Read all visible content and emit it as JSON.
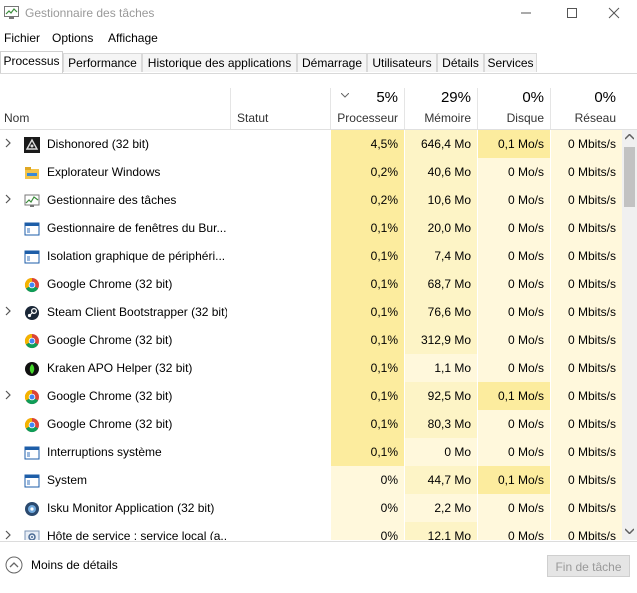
{
  "window": {
    "title": "Gestionnaire des tâches"
  },
  "menu": [
    "Fichier",
    "Options",
    "Affichage"
  ],
  "tabs": [
    "Processus",
    "Performance",
    "Historique des applications",
    "Démarrage",
    "Utilisateurs",
    "Détails",
    "Services"
  ],
  "columns": {
    "name": "Nom",
    "status": "Statut",
    "cpu": {
      "pct": "5%",
      "label": "Processeur"
    },
    "mem": {
      "pct": "29%",
      "label": "Mémoire"
    },
    "disk": {
      "pct": "0%",
      "label": "Disque"
    },
    "net": {
      "pct": "0%",
      "label": "Réseau"
    }
  },
  "colors": {
    "heat_strong": "#fcec9e",
    "heat_light": "#fdf4c6",
    "heat_pale": "#fff8dc"
  },
  "rows": [
    {
      "name": "Dishonored (32 bit)",
      "icon": "dishonored-icon",
      "expand": true,
      "cpu": "4,5%",
      "mem": "646,4 Mo",
      "disk": "0,1 Mo/s",
      "net": "0 Mbits/s"
    },
    {
      "name": "Explorateur Windows",
      "icon": "folder-icon",
      "expand": false,
      "cpu": "0,2%",
      "mem": "40,6 Mo",
      "disk": "0 Mo/s",
      "net": "0 Mbits/s"
    },
    {
      "name": "Gestionnaire des tâches",
      "icon": "task-manager-icon",
      "expand": true,
      "cpu": "0,2%",
      "mem": "10,6 Mo",
      "disk": "0 Mo/s",
      "net": "0 Mbits/s"
    },
    {
      "name": "Gestionnaire de fenêtres du Bur...",
      "icon": "window-icon",
      "expand": false,
      "cpu": "0,1%",
      "mem": "20,0 Mo",
      "disk": "0 Mo/s",
      "net": "0 Mbits/s"
    },
    {
      "name": "Isolation graphique de périphéri...",
      "icon": "window-icon",
      "expand": false,
      "cpu": "0,1%",
      "mem": "7,4 Mo",
      "disk": "0 Mo/s",
      "net": "0 Mbits/s"
    },
    {
      "name": "Google Chrome (32 bit)",
      "icon": "chrome-icon",
      "expand": false,
      "cpu": "0,1%",
      "mem": "68,7 Mo",
      "disk": "0 Mo/s",
      "net": "0 Mbits/s"
    },
    {
      "name": "Steam Client Bootstrapper (32 bit)",
      "icon": "steam-icon",
      "expand": true,
      "cpu": "0,1%",
      "mem": "76,6 Mo",
      "disk": "0 Mo/s",
      "net": "0 Mbits/s"
    },
    {
      "name": "Google Chrome (32 bit)",
      "icon": "chrome-icon",
      "expand": false,
      "cpu": "0,1%",
      "mem": "312,9 Mo",
      "disk": "0 Mo/s",
      "net": "0 Mbits/s"
    },
    {
      "name": "Kraken APO Helper (32 bit)",
      "icon": "razer-icon",
      "expand": false,
      "cpu": "0,1%",
      "mem": "1,1 Mo",
      "disk": "0 Mo/s",
      "net": "0 Mbits/s"
    },
    {
      "name": "Google Chrome (32 bit)",
      "icon": "chrome-icon",
      "expand": true,
      "cpu": "0,1%",
      "mem": "92,5 Mo",
      "disk": "0,1 Mo/s",
      "net": "0 Mbits/s"
    },
    {
      "name": "Google Chrome (32 bit)",
      "icon": "chrome-icon",
      "expand": false,
      "cpu": "0,1%",
      "mem": "80,3 Mo",
      "disk": "0 Mo/s",
      "net": "0 Mbits/s"
    },
    {
      "name": "Interruptions système",
      "icon": "window-icon",
      "expand": false,
      "cpu": "0,1%",
      "mem": "0 Mo",
      "disk": "0 Mo/s",
      "net": "0 Mbits/s"
    },
    {
      "name": "System",
      "icon": "window-icon",
      "expand": false,
      "cpu": "0%",
      "mem": "44,7 Mo",
      "disk": "0,1 Mo/s",
      "net": "0 Mbits/s"
    },
    {
      "name": "Isku Monitor Application (32 bit)",
      "icon": "isku-icon",
      "expand": false,
      "cpu": "0%",
      "mem": "2,2 Mo",
      "disk": "0 Mo/s",
      "net": "0 Mbits/s"
    },
    {
      "name": "Hôte de service : service local (a...",
      "icon": "gear-icon",
      "expand": true,
      "cpu": "0%",
      "mem": "12,1 Mo",
      "disk": "0 Mo/s",
      "net": "0 Mbits/s"
    }
  ],
  "footer": {
    "fewer_details": "Moins de détails",
    "end_task": "Fin de tâche"
  }
}
